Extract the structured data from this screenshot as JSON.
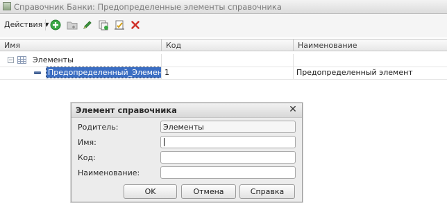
{
  "window": {
    "title": "Справочник Банки: Предопределенные элементы справочника"
  },
  "toolbar": {
    "actions_label": "Действия",
    "icons": [
      "add-icon",
      "add-group-icon",
      "edit-icon",
      "copy-icon",
      "mark-icon",
      "delete-icon"
    ],
    "colors": {
      "add": "#3aa845",
      "edit": "#2e8b2e",
      "delete": "#d0342c"
    }
  },
  "table": {
    "columns": [
      "Имя",
      "Код",
      "Наименование"
    ],
    "rows": [
      {
        "name": "Элементы",
        "code": "",
        "title": ""
      },
      {
        "name": "Предопределенный_Элемент",
        "code": "1",
        "title": "Предопределенный элемент"
      }
    ],
    "selection_color": "#3b6ec3"
  },
  "dialog": {
    "title": "Элемент справочника",
    "labels": {
      "parent": "Родитель:",
      "name": "Имя:",
      "code": "Код:",
      "title": "Наименование:"
    },
    "values": {
      "parent": "Элементы",
      "name": "",
      "code": "",
      "title": ""
    },
    "buttons": {
      "ok": "OK",
      "cancel": "Отмена",
      "help": "Справка"
    }
  }
}
